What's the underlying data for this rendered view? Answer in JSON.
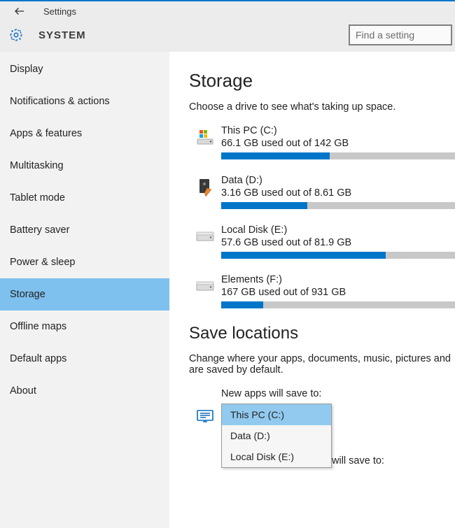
{
  "window_title": "Settings",
  "section": "SYSTEM",
  "search": {
    "placeholder": "Find a setting"
  },
  "sidebar": {
    "items": [
      {
        "label": "Display"
      },
      {
        "label": "Notifications & actions"
      },
      {
        "label": "Apps & features"
      },
      {
        "label": "Multitasking"
      },
      {
        "label": "Tablet mode"
      },
      {
        "label": "Battery saver"
      },
      {
        "label": "Power & sleep"
      },
      {
        "label": "Storage",
        "selected": true
      },
      {
        "label": "Offline maps"
      },
      {
        "label": "Default apps"
      },
      {
        "label": "About"
      }
    ]
  },
  "storage": {
    "heading": "Storage",
    "subheading": "Choose a drive to see what's taking up space.",
    "drives": [
      {
        "name": "This PC (C:)",
        "usage": "66.1 GB used out of 142 GB",
        "percent": 46.5,
        "icon": "windows-drive"
      },
      {
        "name": "Data (D:)",
        "usage": "3.16 GB used out of 8.61 GB",
        "percent": 36.7,
        "icon": "hdd-check"
      },
      {
        "name": "Local Disk (E:)",
        "usage": "57.6 GB used out of 81.9 GB",
        "percent": 70.3,
        "icon": "drive"
      },
      {
        "name": "Elements (F:)",
        "usage": "167 GB used out of 931 GB",
        "percent": 17.9,
        "icon": "drive"
      }
    ]
  },
  "save_locations": {
    "heading": "Save locations",
    "subheading": "Change where your apps, documents, music, pictures and are saved by default.",
    "new_apps_label": "New apps will save to:",
    "dropdown": {
      "options": [
        {
          "label": "This PC (C:)",
          "selected": true
        },
        {
          "label": "Data (D:)"
        },
        {
          "label": "Local Disk (E:)"
        }
      ]
    },
    "truncated_tail": "will save to:"
  }
}
